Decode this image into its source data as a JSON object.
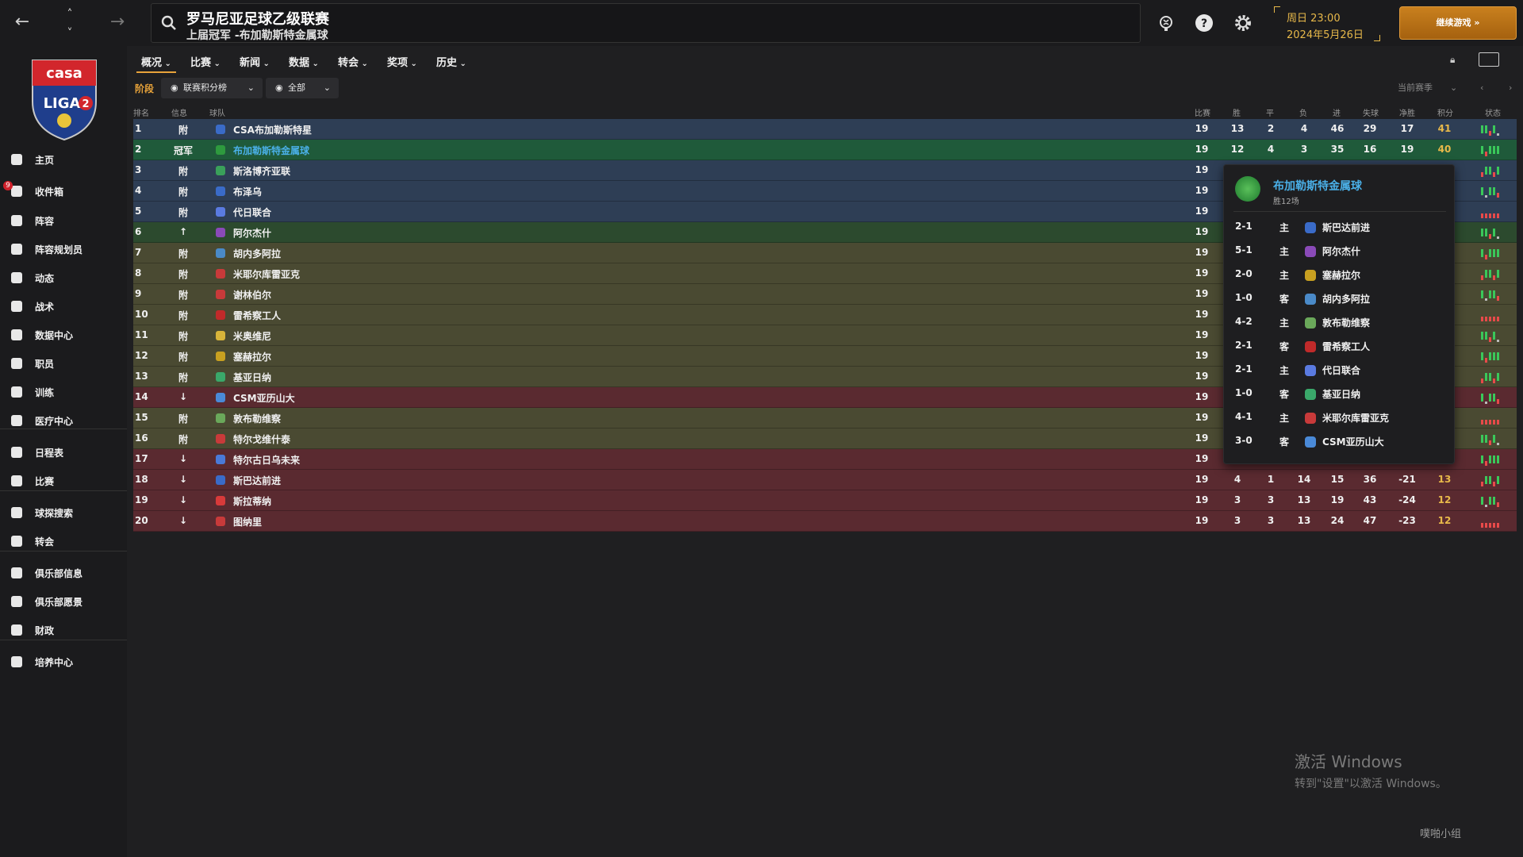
{
  "search": {
    "title": "罗马尼亚足球乙级联赛",
    "subtitle": "上届冠军 -布加勒斯特金属球"
  },
  "datetime": {
    "day_time": "周日 23:00",
    "date": "2024年5月26日"
  },
  "continue_label": "继续游戏",
  "sidebar": {
    "items": [
      {
        "label": "主页",
        "icon": "home-icon"
      },
      {
        "label": "收件箱",
        "icon": "inbox-icon",
        "badge": "9"
      },
      {
        "label": "阵容",
        "icon": "shirt-icon"
      },
      {
        "label": "阵容规划员",
        "icon": "clipboard-icon"
      },
      {
        "label": "动态",
        "icon": "refresh-icon"
      },
      {
        "label": "战术",
        "icon": "tactics-icon"
      },
      {
        "label": "数据中心",
        "icon": "data-icon"
      },
      {
        "label": "职员",
        "icon": "staff-icon"
      },
      {
        "label": "训练",
        "icon": "training-icon"
      },
      {
        "label": "医疗中心",
        "icon": "medical-icon"
      },
      {
        "label": "日程表",
        "icon": "calendar-icon"
      },
      {
        "label": "比赛",
        "icon": "trophy-icon"
      },
      {
        "label": "球探搜索",
        "icon": "scout-icon"
      },
      {
        "label": "转会",
        "icon": "transfer-icon"
      },
      {
        "label": "俱乐部信息",
        "icon": "shield-icon"
      },
      {
        "label": "俱乐部愿景",
        "icon": "vision-icon"
      },
      {
        "label": "财政",
        "icon": "finance-icon"
      },
      {
        "label": "培养中心",
        "icon": "development-icon"
      }
    ]
  },
  "tabs": [
    "概况",
    "比赛",
    "新闻",
    "数据",
    "转会",
    "奖项",
    "历史"
  ],
  "filters": {
    "stage_label": "阶段",
    "table_filter": "联赛积分榜",
    "scope_filter": "全部",
    "season_filter": "当前赛季"
  },
  "table": {
    "headers": {
      "rank": "排名",
      "info": "信息",
      "team": "球队",
      "played": "比赛",
      "won": "胜",
      "drawn": "平",
      "lost": "负",
      "gf": "进",
      "ga": "失球",
      "gd": "净胜",
      "pts": "积分",
      "form": "状态"
    },
    "rows": [
      {
        "rank": "1",
        "info": "附",
        "team": "CSA布加勒斯特星",
        "played": "19",
        "won": "13",
        "drawn": "2",
        "lost": "4",
        "gf": "46",
        "ga": "29",
        "gd": "17",
        "pts": "41",
        "zone": "blue",
        "logo": "#3a6bc8"
      },
      {
        "rank": "2",
        "info": "冠军",
        "team": "布加勒斯特金属球",
        "played": "19",
        "won": "12",
        "drawn": "4",
        "lost": "3",
        "gf": "35",
        "ga": "16",
        "gd": "19",
        "pts": "40",
        "zone": "green",
        "logo": "#2e9a3e",
        "highlight": true
      },
      {
        "rank": "3",
        "info": "附",
        "team": "斯洛博齐亚联",
        "played": "19",
        "zone": "blue",
        "logo": "#3aa05a"
      },
      {
        "rank": "4",
        "info": "附",
        "team": "布泽乌",
        "played": "19",
        "zone": "blue",
        "logo": "#3a6bc8"
      },
      {
        "rank": "5",
        "info": "附",
        "team": "代日联合",
        "played": "19",
        "zone": "blue",
        "logo": "#5a7ae0"
      },
      {
        "rank": "6",
        "info": "↑",
        "team": "阿尔杰什",
        "played": "19",
        "zone": "darkgreen",
        "logo": "#8a4ab8"
      },
      {
        "rank": "7",
        "info": "附",
        "team": "胡内多阿拉",
        "played": "19",
        "zone": "olive",
        "logo": "#4a8ac8"
      },
      {
        "rank": "8",
        "info": "附",
        "team": "米耶尔库雷亚克",
        "played": "19",
        "zone": "olive",
        "logo": "#c83a3a"
      },
      {
        "rank": "9",
        "info": "附",
        "team": "谢林伯尔",
        "played": "19",
        "zone": "olive",
        "logo": "#c83a3a"
      },
      {
        "rank": "10",
        "info": "附",
        "team": "雷希察工人",
        "played": "19",
        "zone": "olive",
        "logo": "#c02a2a"
      },
      {
        "rank": "11",
        "info": "附",
        "team": "米奥维尼",
        "played": "19",
        "zone": "olive",
        "logo": "#d8b43a"
      },
      {
        "rank": "12",
        "info": "附",
        "team": "塞赫拉尔",
        "played": "19",
        "zone": "olive",
        "logo": "#c8a020"
      },
      {
        "rank": "13",
        "info": "附",
        "team": "基亚日纳",
        "played": "19",
        "zone": "olive",
        "logo": "#3aa86a"
      },
      {
        "rank": "14",
        "info": "↓",
        "team": "CSM亚历山大",
        "played": "19",
        "zone": "red",
        "logo": "#4a8ad8"
      },
      {
        "rank": "15",
        "info": "附",
        "team": "敦布勒维察",
        "played": "19",
        "zone": "olive",
        "logo": "#6aa85a"
      },
      {
        "rank": "16",
        "info": "附",
        "team": "特尔戈维什泰",
        "played": "19",
        "zone": "olive",
        "logo": "#c83a3a"
      },
      {
        "rank": "17",
        "info": "↓",
        "team": "特尔古日乌未来",
        "played": "19",
        "zone": "red",
        "logo": "#4a7ad8"
      },
      {
        "rank": "18",
        "info": "↓",
        "team": "斯巴达前进",
        "played": "19",
        "won": "4",
        "drawn": "1",
        "lost": "14",
        "gf": "15",
        "ga": "36",
        "gd": "-21",
        "pts": "13",
        "zone": "red",
        "logo": "#3a6bc8"
      },
      {
        "rank": "19",
        "info": "↓",
        "team": "斯拉蒂纳",
        "played": "19",
        "won": "3",
        "drawn": "3",
        "lost": "13",
        "gf": "19",
        "ga": "43",
        "gd": "-24",
        "pts": "12",
        "zone": "red",
        "logo": "#d83a3a"
      },
      {
        "rank": "20",
        "info": "↓",
        "team": "图纳里",
        "played": "19",
        "won": "3",
        "drawn": "3",
        "lost": "13",
        "gf": "24",
        "ga": "47",
        "gd": "-23",
        "pts": "12",
        "zone": "red",
        "logo": "#c83a3a"
      }
    ]
  },
  "popup": {
    "team": "布加勒斯特金属球",
    "subtitle": "胜12场",
    "matches": [
      {
        "score": "2-1",
        "venue": "主",
        "opponent": "斯巴达前进",
        "logo": "#3a6bc8"
      },
      {
        "score": "5-1",
        "venue": "主",
        "opponent": "阿尔杰什",
        "logo": "#8a4ab8"
      },
      {
        "score": "2-0",
        "venue": "主",
        "opponent": "塞赫拉尔",
        "logo": "#c8a020"
      },
      {
        "score": "1-0",
        "venue": "客",
        "opponent": "胡内多阿拉",
        "logo": "#4a8ac8"
      },
      {
        "score": "4-2",
        "venue": "主",
        "opponent": "敦布勒维察",
        "logo": "#6aa85a"
      },
      {
        "score": "2-1",
        "venue": "客",
        "opponent": "雷希察工人",
        "logo": "#c02a2a"
      },
      {
        "score": "2-1",
        "venue": "主",
        "opponent": "代日联合",
        "logo": "#5a7ae0"
      },
      {
        "score": "1-0",
        "venue": "客",
        "opponent": "基亚日纳",
        "logo": "#3aa86a"
      },
      {
        "score": "4-1",
        "venue": "主",
        "opponent": "米耶尔库雷亚克",
        "logo": "#c83a3a"
      },
      {
        "score": "3-0",
        "venue": "客",
        "opponent": "CSM亚历山大",
        "logo": "#4a8ad8"
      }
    ]
  },
  "watermark": {
    "line1": "激活 Windows",
    "line2": "转到\"设置\"以激活 Windows。"
  },
  "site_logo": "噗啪小组"
}
